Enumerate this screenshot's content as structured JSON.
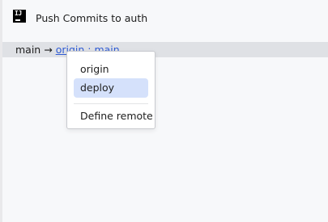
{
  "window": {
    "title": "Push Commits to auth"
  },
  "branch": {
    "local": "main",
    "arrow": "→",
    "remote": "origin",
    "separator": ":",
    "remote_branch": "main"
  },
  "remote_menu": {
    "items": [
      {
        "label": "origin",
        "selected": false
      },
      {
        "label": "deploy",
        "selected": true
      }
    ],
    "define_label": "Define remote"
  },
  "colors": {
    "link": "#2f5bd3",
    "selection": "#d5e1fb",
    "branch_bar": "#dfe1e5",
    "window_bg": "#f7f8fa"
  },
  "icons": {
    "app": "intellij-app-icon"
  }
}
